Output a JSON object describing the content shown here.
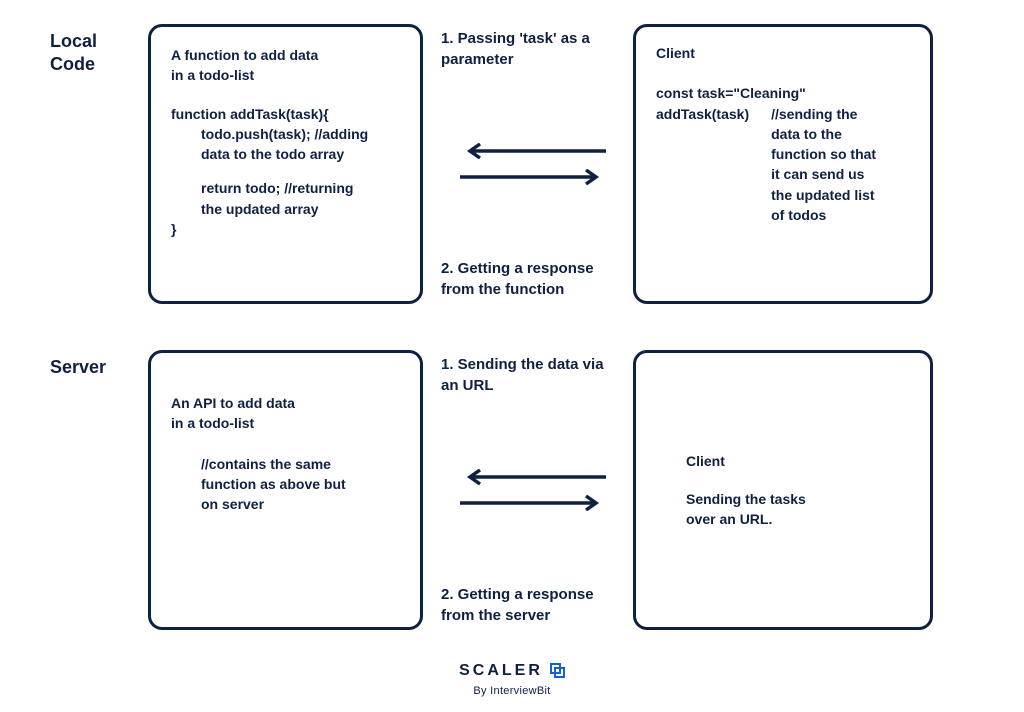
{
  "row1": {
    "label_line1": "Local",
    "label_line2": "Code",
    "left": {
      "desc1": "A function to add data",
      "desc2": "in a todo-list",
      "code1": "function addTask(task){",
      "code2": "todo.push(task); //adding",
      "code3": "data to the todo array",
      "code4": "return todo; //returning",
      "code5": "the updated array",
      "code6": "}"
    },
    "mid": {
      "top1": "1. Passing 'task' as a",
      "top2": "parameter",
      "bot1": "2. Getting a response",
      "bot2": "from the function"
    },
    "right": {
      "title": "Client",
      "line1": "const task=\"Cleaning\"",
      "line2a": "addTask(task)",
      "line2b1": "//sending the",
      "line2b2": "data to the",
      "line2b3": "function so that",
      "line2b4": "it can send us",
      "line2b5": "the updated list",
      "line2b6": "of todos"
    }
  },
  "row2": {
    "label": "Server",
    "left": {
      "desc1": "An API to add data",
      "desc2": "in a todo-list",
      "body1": "//contains the same",
      "body2": "function as above but",
      "body3": "on server"
    },
    "mid": {
      "top1": "1. Sending the data via",
      "top2": "an URL",
      "bot1": "2. Getting a response",
      "bot2": "from the server"
    },
    "right": {
      "title": "Client",
      "body1": "Sending the tasks",
      "body2": "over an URL."
    }
  },
  "footer": {
    "brand": "SCALER",
    "sub": "By InterviewBit"
  }
}
